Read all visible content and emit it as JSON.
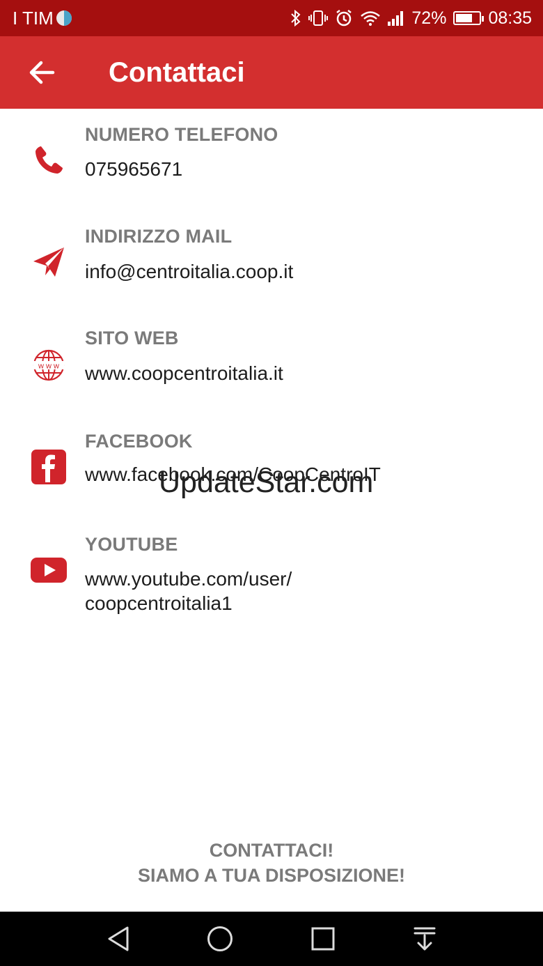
{
  "status_bar": {
    "carrier": "I TIM",
    "carrier_badge": "11",
    "battery_percent": "72%",
    "battery_level": 0.72,
    "time": "08:35"
  },
  "app_bar": {
    "title": "Contattaci"
  },
  "contacts": [
    {
      "label": "NUMERO TELEFONO",
      "value": "075965671",
      "icon": "phone-icon"
    },
    {
      "label": "INDIRIZZO MAIL",
      "value": "info@centroitalia.coop.it",
      "icon": "paper-plane-icon"
    },
    {
      "label": "SITO WEB",
      "value": "www.coopcentroitalia.it",
      "icon": "globe-www-icon"
    },
    {
      "label": "FACEBOOK",
      "value": "www.facebook.com/CoopCentroIT",
      "icon": "facebook-icon"
    },
    {
      "label": "YOUTUBE",
      "value_line1": "www.youtube.com/user/",
      "value_line2": "coopcentroitalia1",
      "icon": "youtube-icon"
    }
  ],
  "watermark": "UpdateStar.com",
  "footer": {
    "line1": "CONTATTACI!",
    "line2": "SIAMO A TUA DISPOSIZIONE!"
  },
  "colors": {
    "status_bar": "#a50f0f",
    "app_bar": "#d32f2f",
    "icon_red": "#d0242b",
    "label_gray": "#7a7a7a"
  }
}
